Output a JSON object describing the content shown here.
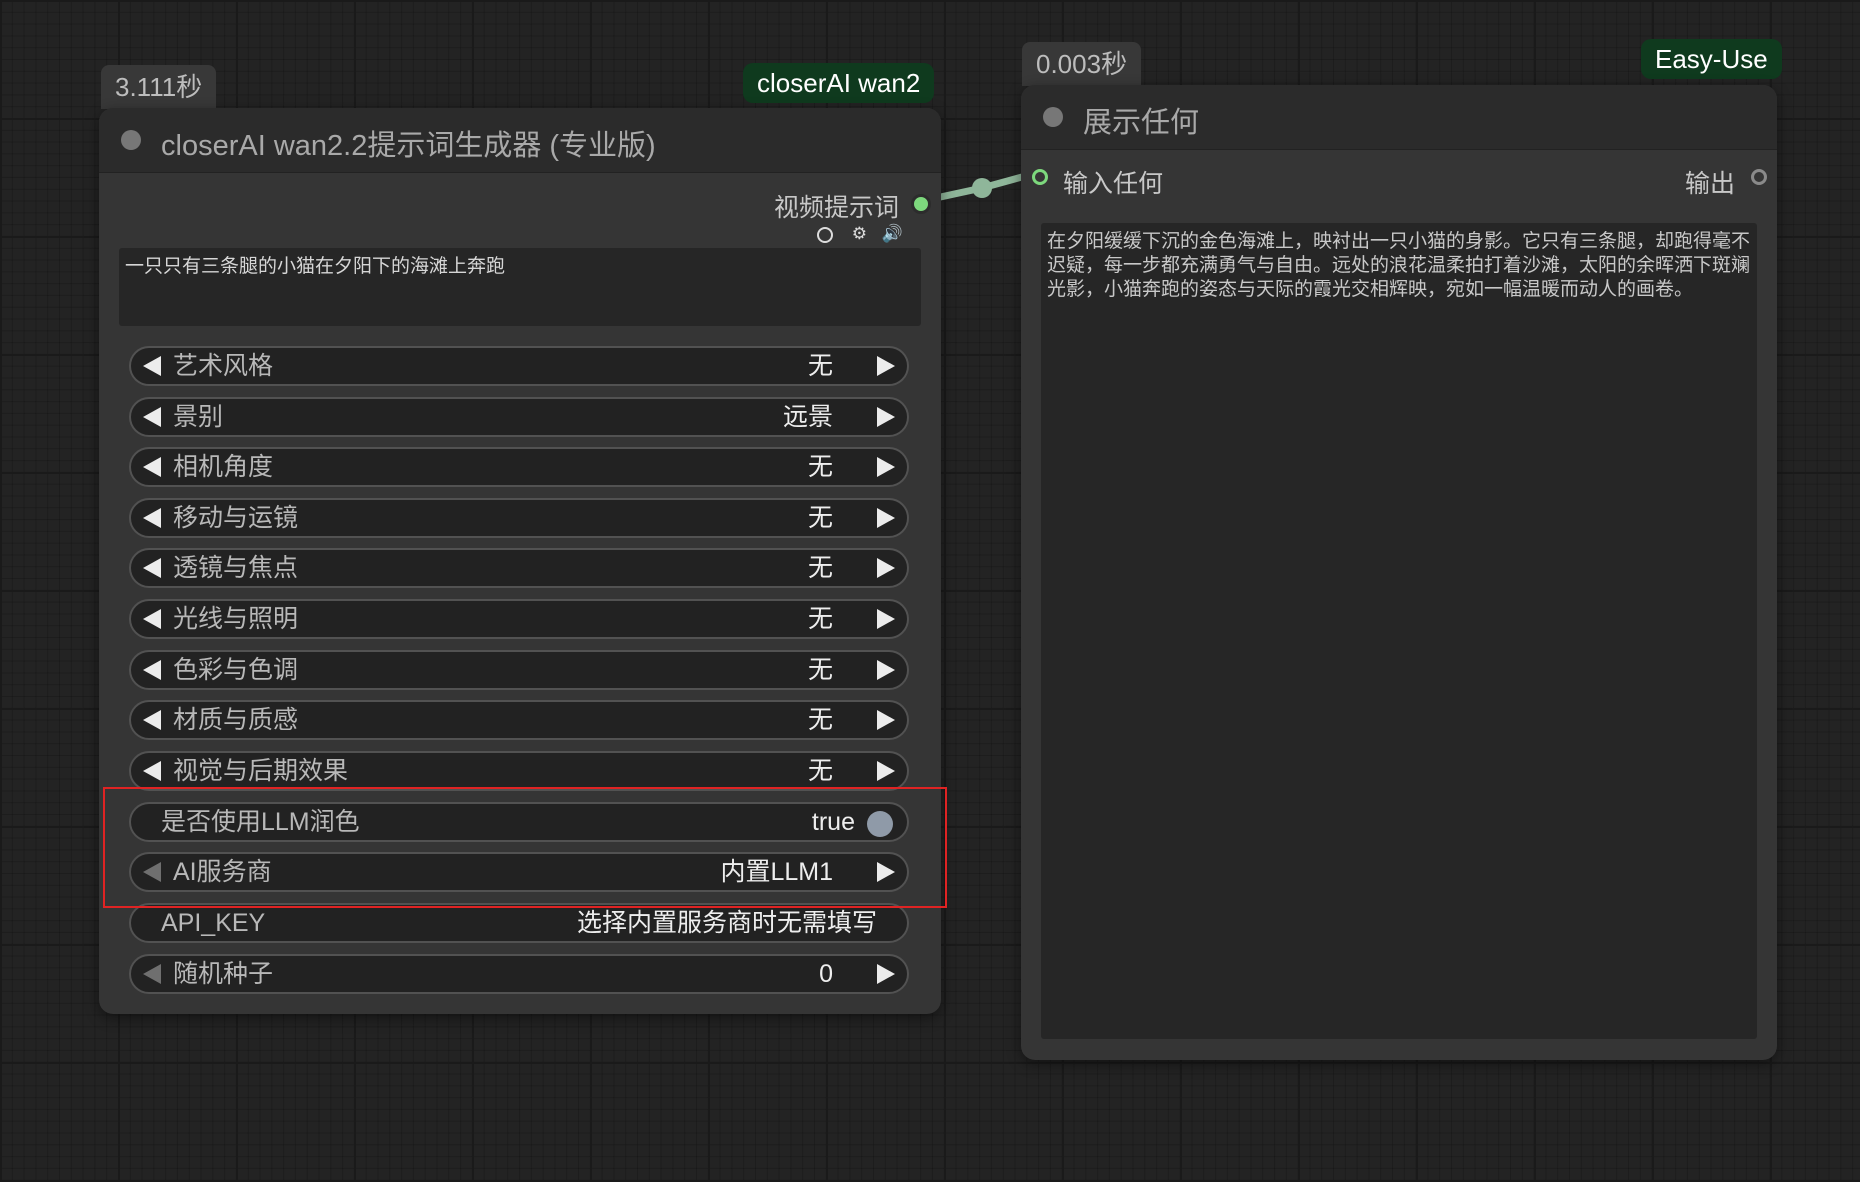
{
  "left_node": {
    "timing_badge": "3.111秒",
    "tag": "closerAI wan2",
    "title": "closerAI wan2.2提示词生成器 (专业版)",
    "output_label": "视频提示词",
    "prompt_text": "一只只有三条腿的小猫在夕阳下的海滩上奔跑",
    "widgets": [
      {
        "label": "艺术风格",
        "value": "无"
      },
      {
        "label": "景别",
        "value": "远景"
      },
      {
        "label": "相机角度",
        "value": "无"
      },
      {
        "label": "移动与运镜",
        "value": "无"
      },
      {
        "label": "透镜与焦点",
        "value": "无"
      },
      {
        "label": "光线与照明",
        "value": "无"
      },
      {
        "label": "色彩与色调",
        "value": "无"
      },
      {
        "label": "材质与质感",
        "value": "无"
      },
      {
        "label": "视觉与后期效果",
        "value": "无"
      }
    ],
    "llm_toggle": {
      "label": "是否使用LLM润色",
      "value": "true"
    },
    "ai_provider": {
      "label": "AI服务商",
      "value": "内置LLM1"
    },
    "api_key": {
      "label": "API_KEY",
      "value": "选择内置服务商时无需填写"
    },
    "seed": {
      "label": "随机种子",
      "value": "0"
    }
  },
  "right_node": {
    "timing_badge": "0.003秒",
    "tag": "Easy-Use",
    "title": "展示任何",
    "input_label": "输入任何",
    "output_label": "输出",
    "display_text": "在夕阳缓缓下沉的金色海滩上，映衬出一只小猫的身影。它只有三条腿，却跑得毫不迟疑，每一步都充满勇气与自由。远处的浪花温柔拍打着沙滩，太阳的余晖洒下斑斓光影，小猫奔跑的姿态与天际的霞光交相辉映，宛如一幅温暖而动人的画卷。"
  },
  "colors": {
    "link": "#8fb69a",
    "slot_active": "#7dd87d",
    "highlight": "#e02323",
    "tag_bg": "#0f3a1e"
  }
}
